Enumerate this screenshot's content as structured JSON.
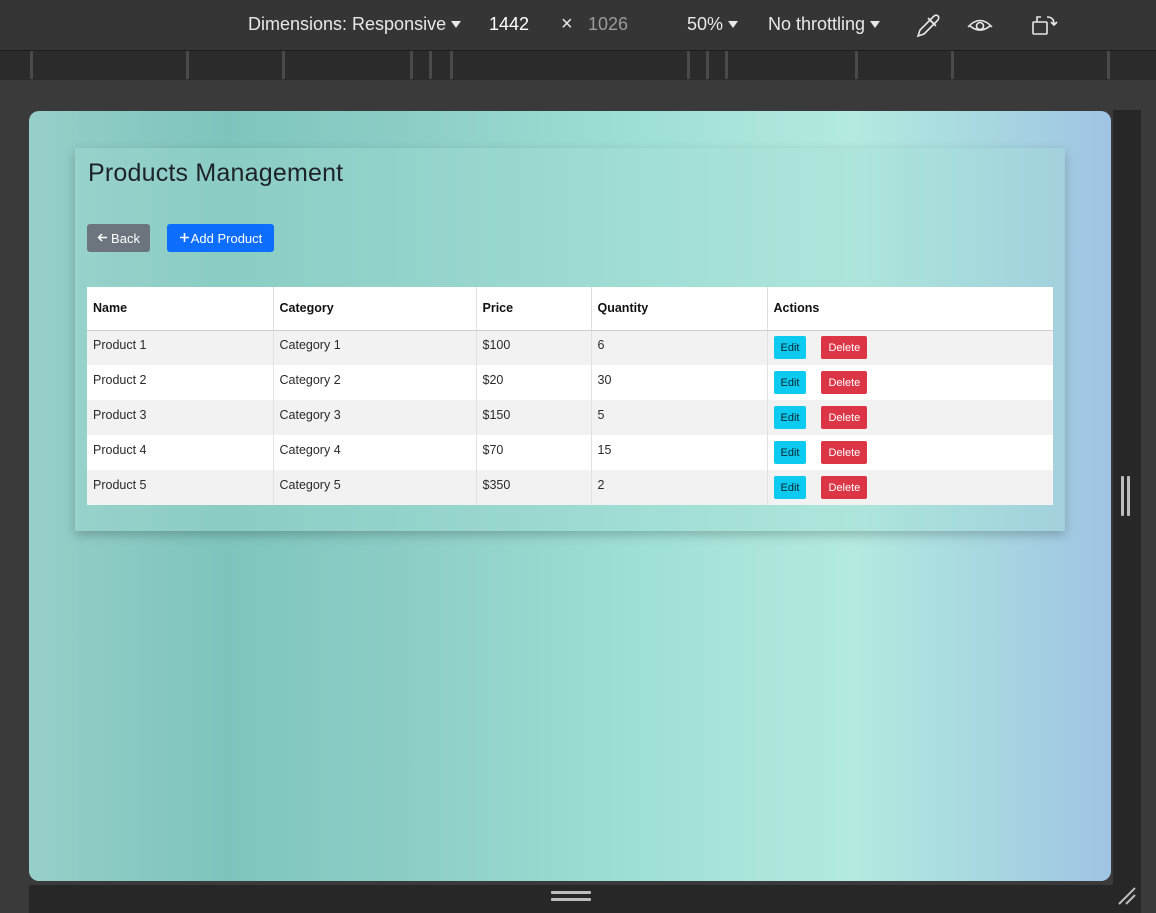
{
  "devtools": {
    "dimensions_label": "Dimensions: Responsive",
    "width": "1442",
    "times": "×",
    "height": "1026",
    "zoom": "50%",
    "throttling": "No throttling"
  },
  "page": {
    "title": "Products Management",
    "back_label": "Back",
    "add_label": "Add Product",
    "table": {
      "headers": [
        "Name",
        "Category",
        "Price",
        "Quantity",
        "Actions"
      ],
      "rows": [
        {
          "name": "Product 1",
          "category": "Category 1",
          "price": "$100",
          "quantity": "6"
        },
        {
          "name": "Product 2",
          "category": "Category 2",
          "price": "$20",
          "quantity": "30"
        },
        {
          "name": "Product 3",
          "category": "Category 3",
          "price": "$150",
          "quantity": "5"
        },
        {
          "name": "Product 4",
          "category": "Category 4",
          "price": "$70",
          "quantity": "15"
        },
        {
          "name": "Product 5",
          "category": "Category 5",
          "price": "$350",
          "quantity": "2"
        }
      ],
      "edit_label": "Edit",
      "delete_label": "Delete"
    }
  },
  "colors": {
    "back_button": "#6c757d",
    "add_button": "#0d6efd",
    "edit_button": "#0dcaf0",
    "delete_button": "#dc3545"
  },
  "icons": {
    "back": "arrow-left-icon",
    "add": "plus-icon",
    "eyedropper": "eyedropper-icon",
    "eye": "eye-icon",
    "rotate": "rotate-icon"
  }
}
